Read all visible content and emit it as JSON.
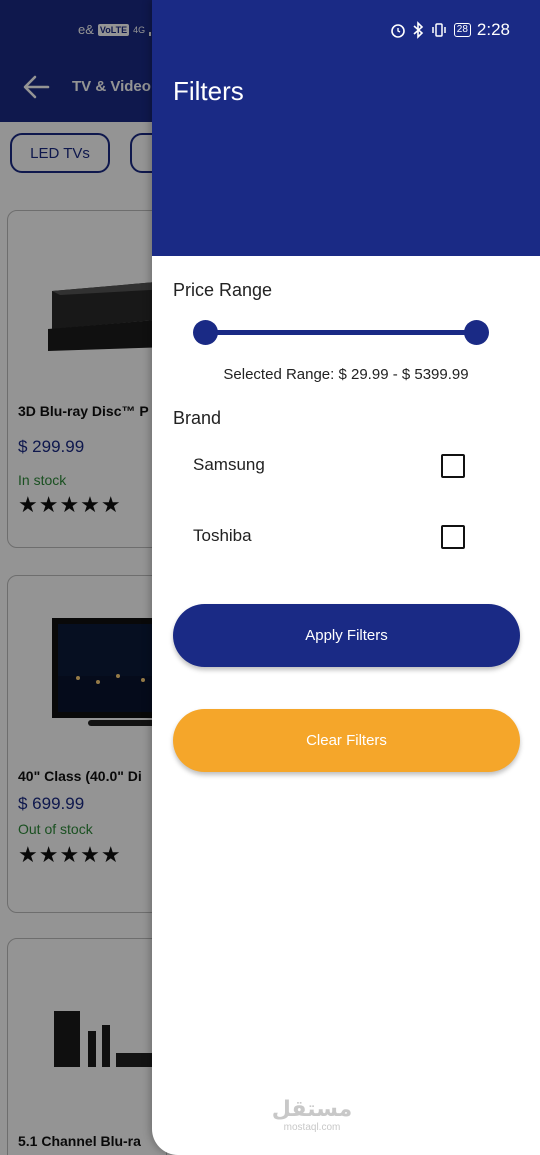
{
  "status_bar": {
    "carrier": "e&",
    "volte": "VoLTE",
    "network": "4G",
    "battery": "28",
    "time": "2:28"
  },
  "background_page": {
    "title": "TV & Video",
    "chips": [
      "LED TVs"
    ],
    "products": [
      {
        "name": "3D Blu-ray Disc™ P",
        "price": "$ 299.99",
        "stock": "In stock",
        "rating": 5
      },
      {
        "name": "40\" Class (40.0\" Di",
        "price": "$ 699.99",
        "stock": "Out of stock",
        "rating": 5
      },
      {
        "name": "5.1 Channel Blu-ra",
        "price": "",
        "stock": "",
        "rating": 0
      }
    ]
  },
  "filters": {
    "title": "Filters",
    "price_range": {
      "label": "Price Range",
      "min": 29.99,
      "max": 5399.99,
      "selected_text": "Selected Range: $ 29.99 - $ 5399.99"
    },
    "brand": {
      "label": "Brand",
      "options": [
        {
          "name": "Samsung",
          "checked": false
        },
        {
          "name": "Toshiba",
          "checked": false
        }
      ]
    },
    "apply_label": "Apply Filters",
    "clear_label": "Clear Filters"
  },
  "watermark": {
    "arabic": "مستقل",
    "latin": "mostaql.com"
  },
  "colors": {
    "primary": "#1a2a85",
    "accent": "#f5a62a",
    "in_stock": "#2e8b3a"
  }
}
